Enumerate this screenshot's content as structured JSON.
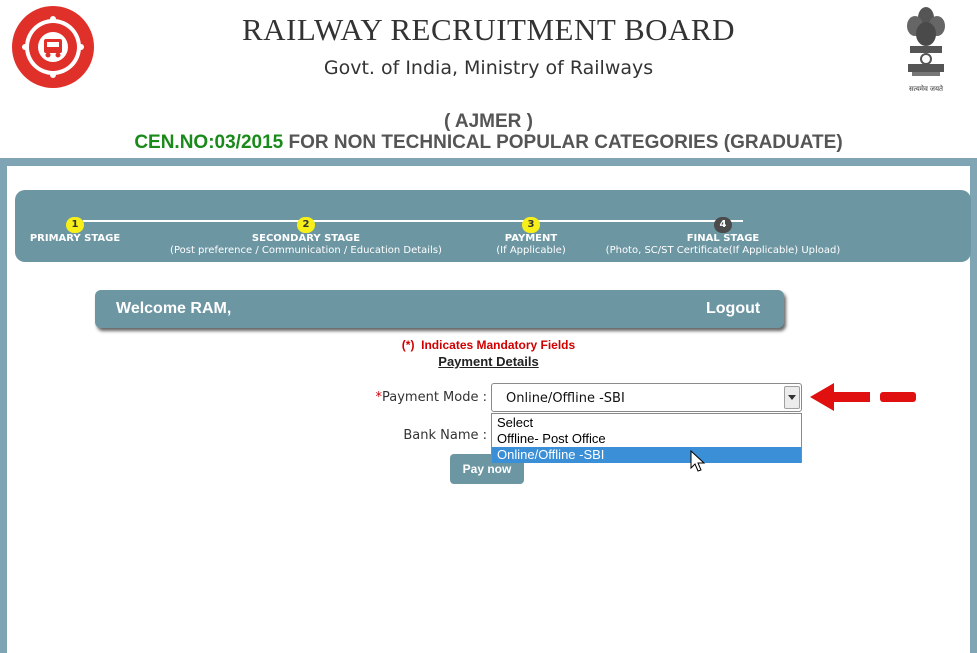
{
  "header": {
    "title": "RAILWAY RECRUITMENT BOARD",
    "subtitle": "Govt. of India, Ministry of Railways",
    "region": "( AJMER )",
    "cen_no": "CEN.NO:03/2015",
    "cen_desc": " FOR NON TECHNICAL POPULAR CATEGORIES (GRADUATE)",
    "emblem_caption": "सत्यमेव जयते"
  },
  "progress": {
    "steps": [
      {
        "num": "1",
        "title": "PRIMARY STAGE",
        "sub": ""
      },
      {
        "num": "2",
        "title": "SECONDARY STAGE",
        "sub": "(Post preference / Communication / Education Details)"
      },
      {
        "num": "3",
        "title": "PAYMENT",
        "sub": "(If Applicable)"
      },
      {
        "num": "4",
        "title": "FINAL STAGE",
        "sub": "(Photo, SC/ST Certificate(If Applicable) Upload)"
      }
    ]
  },
  "welcome": {
    "text": "Welcome RAM,",
    "logout": "Logout"
  },
  "form": {
    "mandatory_star": "(*)",
    "mandatory_text": "Indicates Mandatory Fields",
    "heading": "Payment Details",
    "payment_mode_star": "*",
    "payment_mode_label": "Payment Mode :",
    "payment_mode_value": "Online/Offline -SBI",
    "payment_mode_options": [
      "Select",
      "Offline- Post Office",
      "Online/Offline -SBI"
    ],
    "bank_name_label": "Bank Name :",
    "pay_button": "Pay now"
  },
  "colors": {
    "panel": "#6d96a3",
    "frame": "#7fa4b3",
    "step_active": "#f7ef1a",
    "step_pending": "#4b4b4b",
    "mandatory_red": "#d00000",
    "cen_green": "#1a8a1a",
    "option_highlight": "#3b8fd6",
    "annotation_arrow": "#e01010"
  },
  "icons": {
    "left_logo": "indian-railways-logo",
    "right_logo": "ashoka-emblem",
    "dropdown": "chevron-down-icon",
    "cursor": "mouse-pointer-icon",
    "annotation": "red-arrow-left-icon"
  }
}
